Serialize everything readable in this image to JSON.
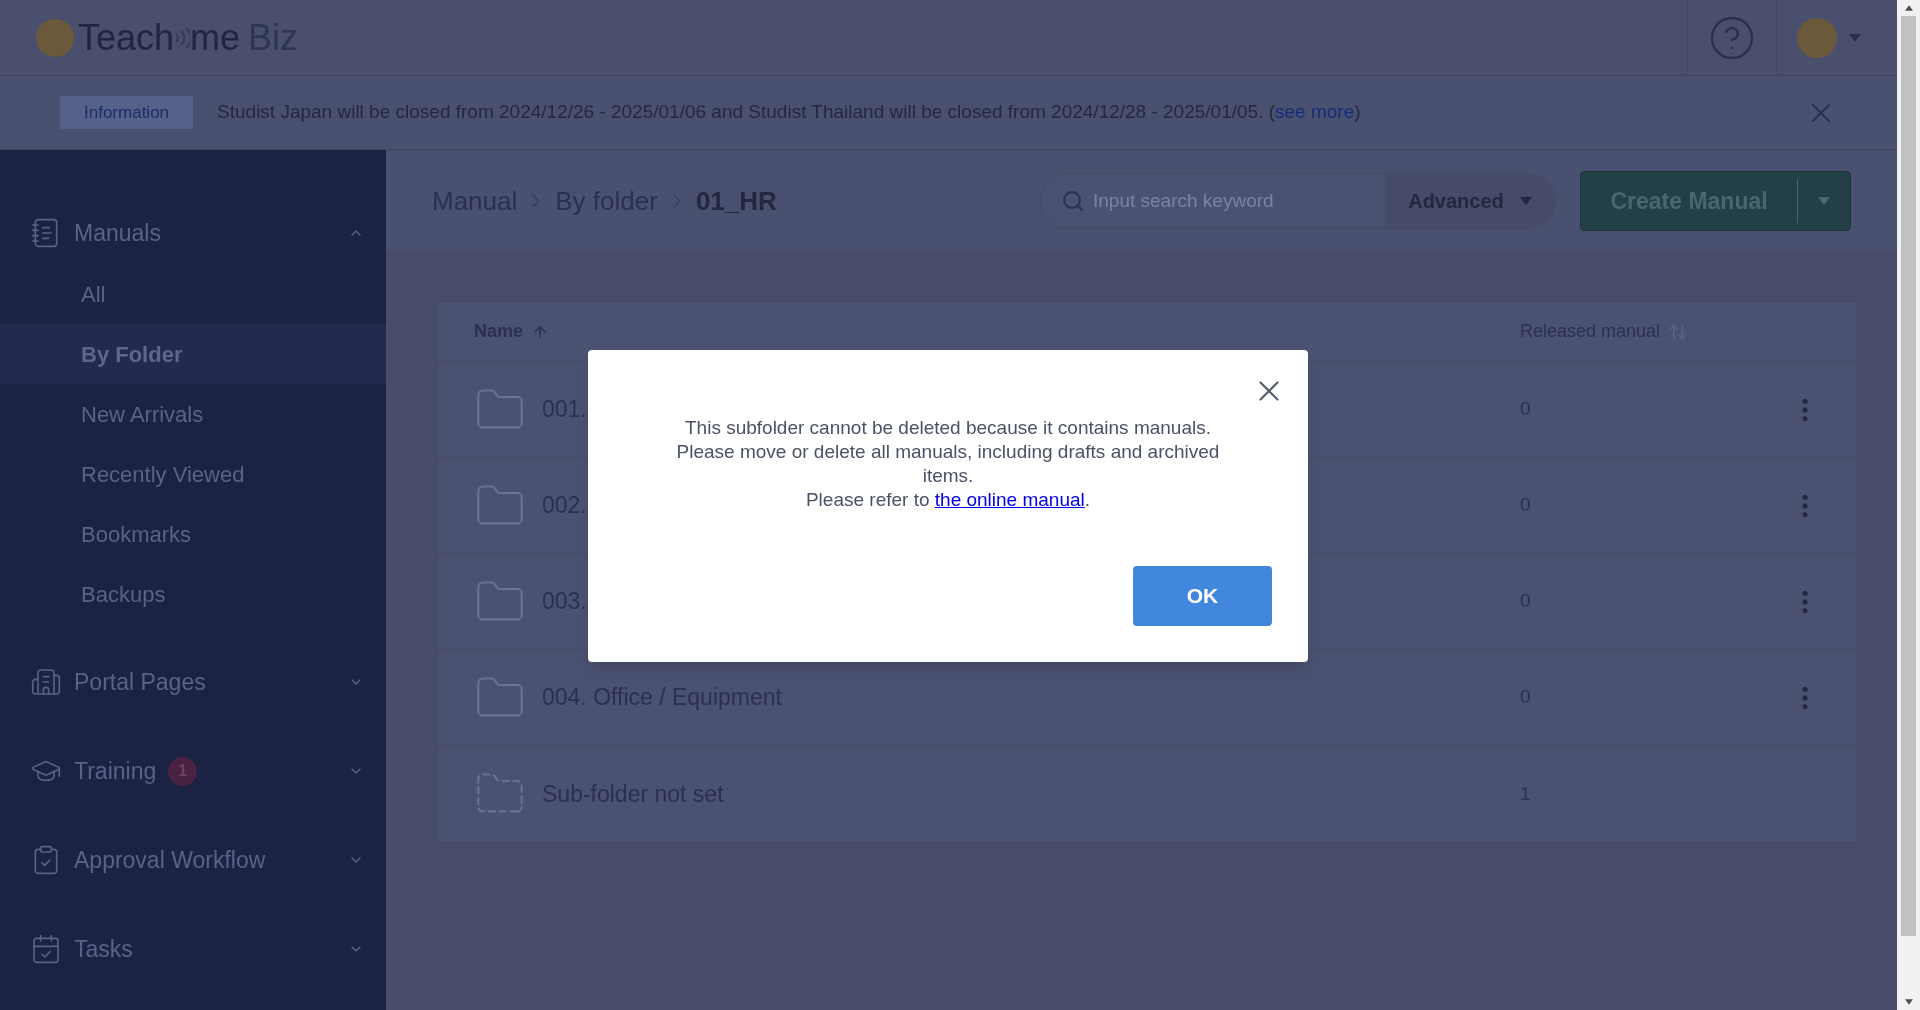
{
  "header": {
    "logo": [
      "Teach",
      "me",
      "Biz"
    ]
  },
  "notice": {
    "badge": "Information",
    "text_before": "Studist Japan will be closed from 2024/12/26 - 2025/01/06 and Studist Thailand will be closed from 2024/12/28 - 2025/01/05. (",
    "link": "see more",
    "text_after": ")"
  },
  "sidebar": {
    "sections": [
      {
        "label": "Manuals",
        "kind": "manuals",
        "expanded": true,
        "children": [
          {
            "label": "All",
            "selected": false
          },
          {
            "label": "By Folder",
            "selected": true
          },
          {
            "label": "New Arrivals",
            "selected": false
          },
          {
            "label": "Recently Viewed",
            "selected": false
          },
          {
            "label": "Bookmarks",
            "selected": false
          },
          {
            "label": "Backups",
            "selected": false
          }
        ]
      },
      {
        "label": "Portal Pages",
        "kind": "portal",
        "expanded": false
      },
      {
        "label": "Training",
        "kind": "training",
        "expanded": false,
        "badge": "1"
      },
      {
        "label": "Approval Workflow",
        "kind": "approval",
        "expanded": false
      },
      {
        "label": "Tasks",
        "kind": "tasks",
        "expanded": false
      }
    ]
  },
  "breadcrumb": [
    "Manual",
    "By folder",
    "01_HR"
  ],
  "search": {
    "placeholder": "Input search keyword",
    "advanced": "Advanced"
  },
  "create_button": "Create Manual",
  "table": {
    "columns": [
      {
        "label": "Name",
        "sorted": true
      },
      {
        "label": "Released manual",
        "sorted": false
      }
    ],
    "rows": [
      {
        "name": "001.",
        "released": "0",
        "kind": "folder"
      },
      {
        "name": "002.",
        "released": "0",
        "kind": "folder"
      },
      {
        "name": "003.",
        "released": "0",
        "kind": "folder"
      },
      {
        "name": "004. Office / Equipment",
        "released": "0",
        "kind": "folder"
      },
      {
        "name": "Sub-folder not set",
        "released": "1",
        "kind": "unset"
      }
    ]
  },
  "dialog": {
    "lines": [
      "This subfolder cannot be deleted because it contains manuals.",
      "Please move or delete all manuals, including drafts and archived items."
    ],
    "refer_before": "Please refer to ",
    "refer_link": "the online manual",
    "refer_after": ".",
    "ok": "OK"
  }
}
